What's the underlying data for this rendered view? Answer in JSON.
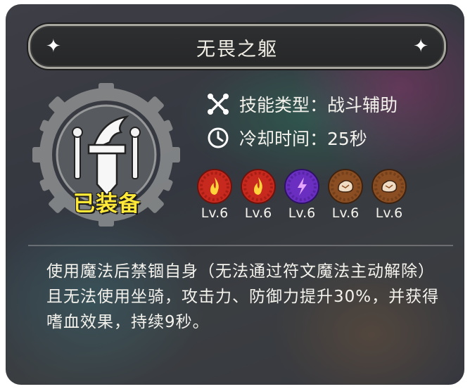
{
  "skill": {
    "title": "无畏之躯",
    "equipped_label": "已装备",
    "type_label": "技能类型：战斗辅助",
    "cooldown_label": "冷却时间：25秒",
    "runes": [
      {
        "icon": "fire-rune-icon",
        "color": "#c8291e",
        "level": "Lv.6"
      },
      {
        "icon": "fire-rune-icon",
        "color": "#c8291e",
        "level": "Lv.6"
      },
      {
        "icon": "lightning-rune-icon",
        "color": "#6a2fc0",
        "level": "Lv.6"
      },
      {
        "icon": "rock-rune-icon",
        "color": "#8a4e22",
        "level": "Lv.6"
      },
      {
        "icon": "rock-rune-icon",
        "color": "#8a4e22",
        "level": "Lv.6"
      }
    ],
    "description": "使用魔法后禁锢自身（无法通过符文魔法主动解除）且无法使用坐骑，攻击力、防御力提升30%，并获得嗜血效果，持续9秒。"
  },
  "colors": {
    "title_border": "#a6a69e",
    "equipped_text": "#ffe838"
  }
}
